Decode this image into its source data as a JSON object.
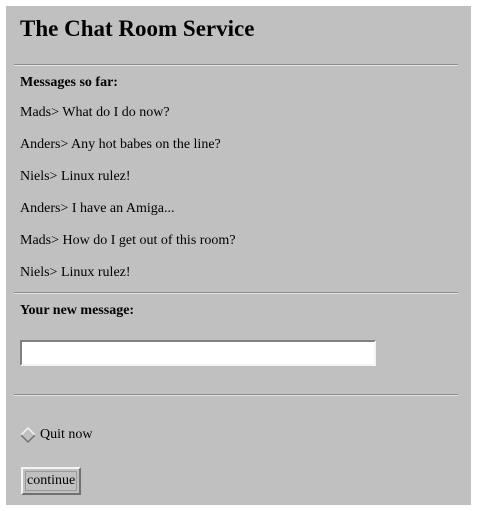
{
  "page": {
    "title": "The Chat Room Service"
  },
  "messages": {
    "heading": "Messages so far:",
    "items": [
      "Mads> What do I do now?",
      "Anders> Any hot babes on the line?",
      "Niels> Linux rulez!",
      "Anders> I have an Amiga...",
      "Mads> How do I get out of this room?",
      "Niels> Linux rulez!"
    ]
  },
  "new_message": {
    "heading": "Your new message:",
    "value": ""
  },
  "quit": {
    "label": "Quit now",
    "checked": false
  },
  "form": {
    "continue_label": "continue"
  },
  "colors": {
    "panel_background": "#c0c0c0",
    "page_background": "#ffffff"
  }
}
